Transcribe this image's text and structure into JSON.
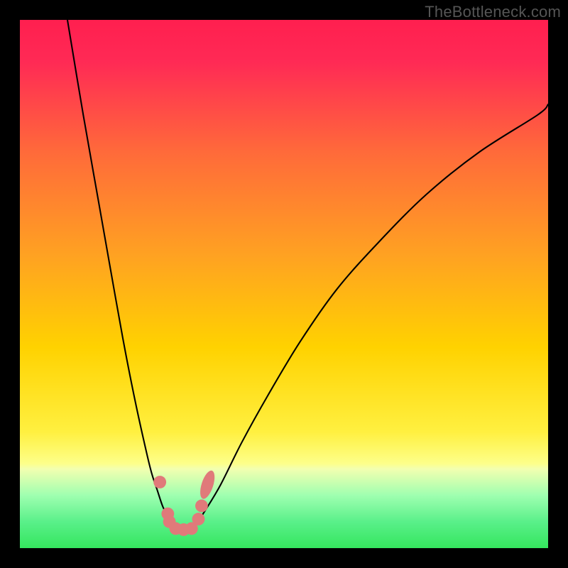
{
  "watermark": "TheBottleneck.com",
  "chart_data": {
    "type": "line",
    "title": "",
    "xlabel": "",
    "ylabel": "",
    "xlim": [
      0,
      100
    ],
    "ylim": [
      0,
      100
    ],
    "background_gradient": {
      "top_color": "#ff2a55",
      "mid_color": "#ffd200",
      "green_band_top": 85,
      "green_band_bottom": 100,
      "green_color": "#37e960"
    },
    "series": [
      {
        "name": "left-branch",
        "x": [
          9,
          12,
          15,
          18,
          20,
          22,
          24,
          25,
          26,
          27,
          28,
          29
        ],
        "y": [
          0,
          18,
          35,
          52,
          63,
          73,
          82,
          86,
          89,
          92,
          94,
          96
        ],
        "stroke": "#000000"
      },
      {
        "name": "right-branch",
        "x": [
          33,
          35,
          38,
          42,
          47,
          53,
          60,
          68,
          77,
          87,
          98,
          100
        ],
        "y": [
          96,
          93,
          88,
          80,
          71,
          61,
          51,
          42,
          33,
          25,
          18,
          16
        ],
        "stroke": "#000000"
      },
      {
        "name": "valley-floor",
        "x": [
          29,
          30,
          31,
          32,
          33
        ],
        "y": [
          96,
          96.5,
          96.5,
          96.5,
          96
        ],
        "stroke": "#000000"
      }
    ],
    "markers": [
      {
        "x": 26.5,
        "y": 87.5,
        "r": 1.2,
        "fill": "#e07a7a"
      },
      {
        "x": 28.0,
        "y": 93.5,
        "r": 1.2,
        "fill": "#e07a7a"
      },
      {
        "x": 28.3,
        "y": 95.0,
        "r": 1.2,
        "fill": "#e07a7a"
      },
      {
        "x": 29.5,
        "y": 96.3,
        "r": 1.2,
        "fill": "#e07a7a"
      },
      {
        "x": 31.0,
        "y": 96.5,
        "r": 1.2,
        "fill": "#e07a7a"
      },
      {
        "x": 32.5,
        "y": 96.3,
        "r": 1.2,
        "fill": "#e07a7a"
      },
      {
        "x": 33.8,
        "y": 94.5,
        "r": 1.2,
        "fill": "#e07a7a"
      },
      {
        "x": 34.4,
        "y": 92.0,
        "r": 1.2,
        "fill": "#e07a7a"
      },
      {
        "x": 35.5,
        "y": 88.0,
        "r": 2.0,
        "fill": "#e07a7a",
        "elongated": true
      }
    ]
  }
}
